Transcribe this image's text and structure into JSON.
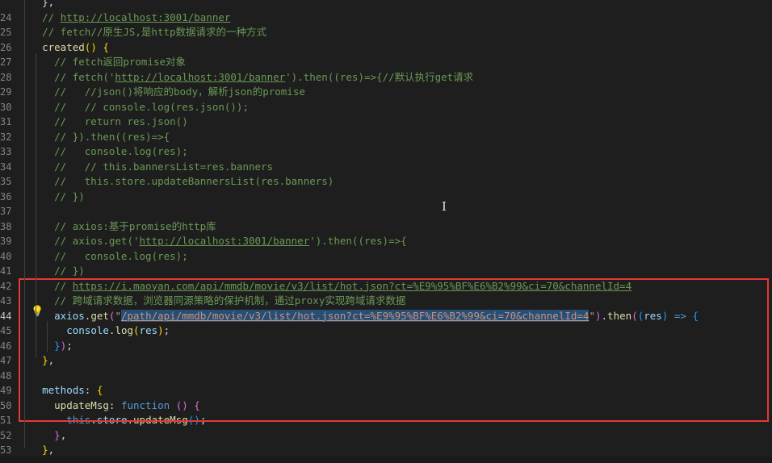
{
  "editor": {
    "lines": [
      {
        "n": "",
        "tokens": [
          {
            "t": "    },",
            "c": ""
          }
        ]
      },
      {
        "n": "24",
        "tokens": [
          {
            "t": "    // ",
            "c": "c"
          },
          {
            "t": "http://localhost:3001/banner",
            "c": "u"
          }
        ]
      },
      {
        "n": "25",
        "tokens": [
          {
            "t": "    // fetch//原生JS,是http数据请求的一种方式",
            "c": "c"
          }
        ]
      },
      {
        "n": "26",
        "tokens": [
          {
            "t": "    ",
            "c": ""
          },
          {
            "t": "created",
            "c": "f"
          },
          {
            "t": "() {",
            "c": "b1"
          }
        ]
      },
      {
        "n": "27",
        "tokens": [
          {
            "t": "      // fetch返回promise对象",
            "c": "c"
          }
        ]
      },
      {
        "n": "28",
        "tokens": [
          {
            "t": "      // fetch('",
            "c": "c"
          },
          {
            "t": "http://localhost:3001/banner",
            "c": "u"
          },
          {
            "t": "').then((res)=>{//默认执行get请求",
            "c": "c"
          }
        ]
      },
      {
        "n": "29",
        "tokens": [
          {
            "t": "      //   //json()将响应的body，解析json的promise",
            "c": "c"
          }
        ]
      },
      {
        "n": "30",
        "tokens": [
          {
            "t": "      //   // console.log(res.json());",
            "c": "c"
          }
        ]
      },
      {
        "n": "31",
        "tokens": [
          {
            "t": "      //   return res.json()",
            "c": "c"
          }
        ]
      },
      {
        "n": "32",
        "tokens": [
          {
            "t": "      // }).then((res)=>{",
            "c": "c"
          }
        ]
      },
      {
        "n": "33",
        "tokens": [
          {
            "t": "      //   console.log(res);",
            "c": "c"
          }
        ]
      },
      {
        "n": "34",
        "tokens": [
          {
            "t": "      //   // this.bannersList=res.banners",
            "c": "c"
          }
        ]
      },
      {
        "n": "35",
        "tokens": [
          {
            "t": "      //   this.store.updateBannersList(res.banners)",
            "c": "c"
          }
        ]
      },
      {
        "n": "36",
        "tokens": [
          {
            "t": "      // })",
            "c": "c"
          }
        ]
      },
      {
        "n": "37",
        "tokens": []
      },
      {
        "n": "38",
        "tokens": [
          {
            "t": "      // axios:基于promise的http库",
            "c": "c"
          }
        ]
      },
      {
        "n": "39",
        "tokens": [
          {
            "t": "      // axios.get('",
            "c": "c"
          },
          {
            "t": "http://localhost:3001/banner",
            "c": "u"
          },
          {
            "t": "').then((res)=>{",
            "c": "c"
          }
        ]
      },
      {
        "n": "40",
        "tokens": [
          {
            "t": "      //   console.log(res);",
            "c": "c"
          }
        ]
      },
      {
        "n": "41",
        "tokens": [
          {
            "t": "      // })",
            "c": "c"
          }
        ]
      },
      {
        "n": "42",
        "tokens": [
          {
            "t": "      // ",
            "c": "c"
          },
          {
            "t": "https://i.maoyan.com/api/mmdb/movie/v3/list/hot.json?ct=%E9%95%BF%E6%B2%99&ci=70&channelId=4",
            "c": "u"
          }
        ]
      },
      {
        "n": "43",
        "tokens": [
          {
            "t": "      // 跨域请求数据，浏览器同源策略的保护机制，通过proxy实现跨域请求数据",
            "c": "c"
          }
        ]
      },
      {
        "n": "44",
        "active": true,
        "tokens": [
          {
            "t": "      ",
            "c": ""
          },
          {
            "t": "axios",
            "c": "p"
          },
          {
            "t": ".",
            "c": ""
          },
          {
            "t": "get",
            "c": "f"
          },
          {
            "t": "(",
            "c": "b2"
          },
          {
            "t": "\"",
            "c": "s"
          },
          {
            "t": "/path/api/mmdb/movie/v3/list/hot.json?ct=%E9%95%BF%E6%B2%99&ci=70&channelId=4",
            "c": "su sel"
          },
          {
            "t": "\"",
            "c": "s"
          },
          {
            "t": ")",
            "c": "b2"
          },
          {
            "t": ".",
            "c": ""
          },
          {
            "t": "then",
            "c": "f"
          },
          {
            "t": "(",
            "c": "b2"
          },
          {
            "t": "(",
            "c": "b3"
          },
          {
            "t": "res",
            "c": "p"
          },
          {
            "t": ")",
            "c": "b3"
          },
          {
            "t": " ",
            "c": ""
          },
          {
            "t": "=>",
            "c": "k"
          },
          {
            "t": " ",
            "c": ""
          },
          {
            "t": "{",
            "c": "b3"
          }
        ]
      },
      {
        "n": "45",
        "tokens": [
          {
            "t": "        ",
            "c": ""
          },
          {
            "t": "console",
            "c": "p"
          },
          {
            "t": ".",
            "c": ""
          },
          {
            "t": "log",
            "c": "f"
          },
          {
            "t": "(",
            "c": "b1"
          },
          {
            "t": "res",
            "c": "p"
          },
          {
            "t": ")",
            "c": "b1"
          },
          {
            "t": ";",
            "c": ""
          }
        ]
      },
      {
        "n": "46",
        "tokens": [
          {
            "t": "      ",
            "c": ""
          },
          {
            "t": "}",
            "c": "b3"
          },
          {
            "t": ")",
            "c": "b2"
          },
          {
            "t": ";",
            "c": ""
          }
        ]
      },
      {
        "n": "47",
        "tokens": [
          {
            "t": "    ",
            "c": ""
          },
          {
            "t": "}",
            "c": "b1"
          },
          {
            "t": ",",
            "c": ""
          }
        ]
      },
      {
        "n": "48",
        "tokens": []
      },
      {
        "n": "49",
        "tokens": [
          {
            "t": "    ",
            "c": ""
          },
          {
            "t": "methods",
            "c": "p"
          },
          {
            "t": ": ",
            "c": ""
          },
          {
            "t": "{",
            "c": "b1"
          }
        ]
      },
      {
        "n": "50",
        "tokens": [
          {
            "t": "      ",
            "c": ""
          },
          {
            "t": "updateMsg",
            "c": "f"
          },
          {
            "t": ": ",
            "c": ""
          },
          {
            "t": "function",
            "c": "k"
          },
          {
            "t": " ",
            "c": ""
          },
          {
            "t": "()",
            "c": "b2"
          },
          {
            "t": " ",
            "c": ""
          },
          {
            "t": "{",
            "c": "b2"
          }
        ]
      },
      {
        "n": "51",
        "tokens": [
          {
            "t": "        ",
            "c": ""
          },
          {
            "t": "this",
            "c": "k"
          },
          {
            "t": ".",
            "c": ""
          },
          {
            "t": "store",
            "c": "p"
          },
          {
            "t": ".",
            "c": ""
          },
          {
            "t": "updateMsg",
            "c": "f"
          },
          {
            "t": "(",
            "c": "b3"
          },
          {
            "t": ")",
            "c": "b3"
          },
          {
            "t": ";",
            "c": ""
          }
        ]
      },
      {
        "n": "52",
        "tokens": [
          {
            "t": "      ",
            "c": ""
          },
          {
            "t": "}",
            "c": "b2"
          },
          {
            "t": ",",
            "c": ""
          }
        ]
      },
      {
        "n": "53",
        "tokens": [
          {
            "t": "    ",
            "c": ""
          },
          {
            "t": "}",
            "c": "b1"
          },
          {
            "t": ",",
            "c": ""
          }
        ]
      }
    ]
  },
  "icons": {
    "lightbulb": "💡",
    "text_cursor": "I"
  },
  "colors": {
    "background": "#1e1e1e",
    "comment": "#6a9955",
    "string": "#ce9178",
    "highlight_box": "#e53935",
    "selection": "#264f78"
  }
}
